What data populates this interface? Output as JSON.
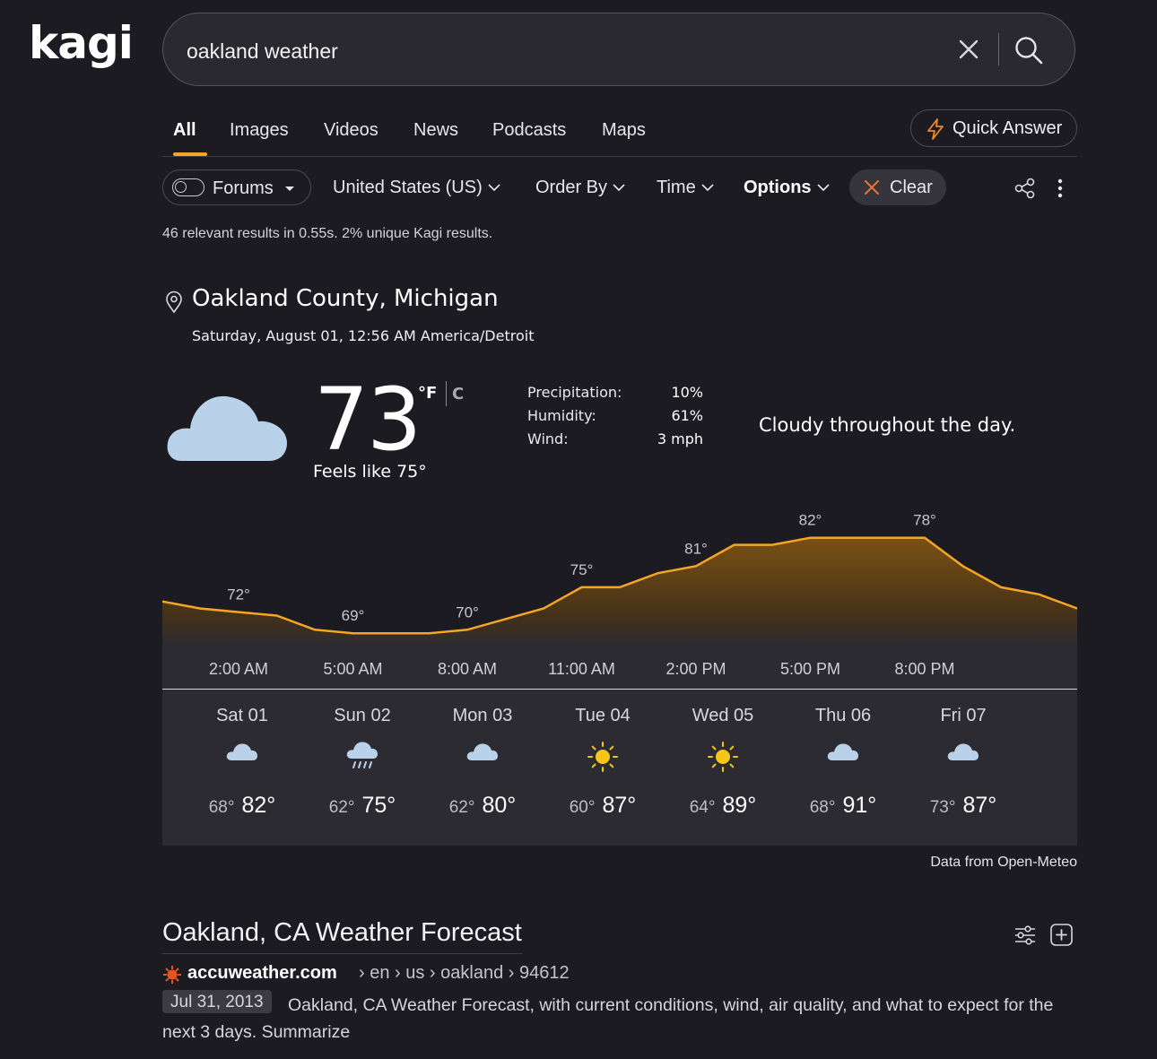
{
  "logo": {
    "text": "kagi"
  },
  "search": {
    "value": "oakland weather",
    "placeholder": ""
  },
  "tabs": [
    {
      "label": "All",
      "active": true
    },
    {
      "label": "Images"
    },
    {
      "label": "Videos"
    },
    {
      "label": "News"
    },
    {
      "label": "Podcasts"
    },
    {
      "label": "Maps"
    }
  ],
  "quick_answer": {
    "label": "Quick Answer"
  },
  "filters": {
    "forums": "Forums",
    "region": "United States (US)",
    "order_by": "Order By",
    "time": "Time",
    "options": "Options",
    "clear": "Clear"
  },
  "stats": "46 relevant results in 0.55s. 2% unique Kagi results.",
  "weather": {
    "location": "Oakland County, Michigan",
    "datetime": "Saturday, August 01, 12:56 AM America/Detroit",
    "temp": "73",
    "unit_f": "°F",
    "unit_c": "C",
    "feels_like": "Feels like 75°",
    "stats": [
      {
        "label": "Precipitation:",
        "value": "10%"
      },
      {
        "label": "Humidity:",
        "value": "61%"
      },
      {
        "label": "Wind:",
        "value": "3 mph"
      }
    ],
    "summary": "Cloudy throughout the day.",
    "credit": "Data from Open-Meteo",
    "accent": "#f5a524"
  },
  "chart_data": {
    "type": "area",
    "x_ticks": [
      "2:00 AM",
      "5:00 AM",
      "8:00 AM",
      "11:00 AM",
      "2:00 PM",
      "5:00 PM",
      "8:00 PM"
    ],
    "values": [
      73,
      72,
      71.5,
      71,
      69,
      68.5,
      68.5,
      68.5,
      69,
      70.5,
      72,
      75,
      75,
      77,
      78,
      81,
      81,
      82,
      82,
      82,
      82,
      78,
      75,
      74,
      72
    ],
    "labels": [
      {
        "index": 2,
        "text": "72°"
      },
      {
        "index": 5,
        "text": "69°"
      },
      {
        "index": 8,
        "text": "70°"
      },
      {
        "index": 11,
        "text": "75°"
      },
      {
        "index": 14,
        "text": "81°"
      },
      {
        "index": 17,
        "text": "82°"
      },
      {
        "index": 20,
        "text": "78°"
      }
    ],
    "line_color": "#f5a524"
  },
  "forecast": [
    {
      "day": "Sat 01",
      "icon": "cloud-icon",
      "lo": "68°",
      "hi": "82°"
    },
    {
      "day": "Sun 02",
      "icon": "rain-icon",
      "lo": "62°",
      "hi": "75°"
    },
    {
      "day": "Mon 03",
      "icon": "cloud-icon",
      "lo": "62°",
      "hi": "80°"
    },
    {
      "day": "Tue 04",
      "icon": "sun-icon",
      "lo": "60°",
      "hi": "87°"
    },
    {
      "day": "Wed 05",
      "icon": "sun-icon",
      "lo": "64°",
      "hi": "89°"
    },
    {
      "day": "Thu 06",
      "icon": "cloud-icon",
      "lo": "68°",
      "hi": "91°"
    },
    {
      "day": "Fri 07",
      "icon": "cloud-icon",
      "lo": "73°",
      "hi": "87°"
    }
  ],
  "result": {
    "title": "Oakland, CA Weather Forecast",
    "domain": "accuweather.com",
    "path": "› en › us › oakland › 94612",
    "date": "Jul 31, 2013",
    "snippet": "Oakland, CA Weather Forecast, with current conditions, wind, air quality, and what to expect for the next 3 days.",
    "summarize": "Summarize"
  }
}
